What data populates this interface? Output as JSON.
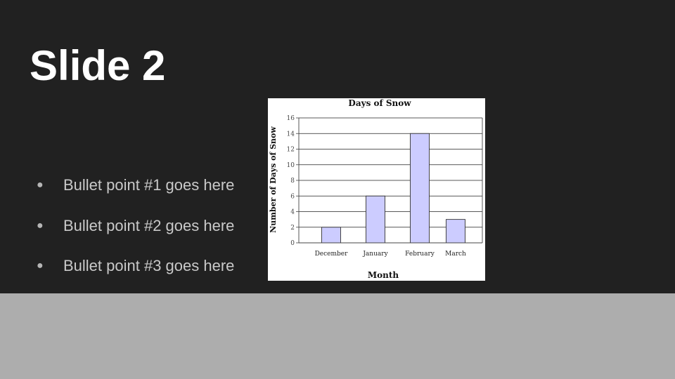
{
  "slide": {
    "title": "Slide 2",
    "bullets": [
      "Bullet point #1 goes here",
      "Bullet point #2 goes here",
      "Bullet point #3 goes here"
    ],
    "bullet_glyph": "●",
    "colors": {
      "slide_background": "#212121",
      "page_background": "#adadad",
      "title": "#ffffff",
      "bullet_text": "#c9c9c9"
    }
  },
  "chart_data": {
    "type": "bar",
    "title": "Days of Snow",
    "xlabel": "Month",
    "ylabel": "Number of Days of Snow",
    "categories": [
      "December",
      "January",
      "February",
      "March"
    ],
    "values": [
      2,
      6,
      14,
      3
    ],
    "ylim": [
      0,
      16
    ],
    "yticks": [
      0,
      2,
      4,
      6,
      8,
      10,
      12,
      14,
      16
    ],
    "grid": true,
    "bar_color": "#ccccff",
    "bar_edge_color": "#333333"
  }
}
